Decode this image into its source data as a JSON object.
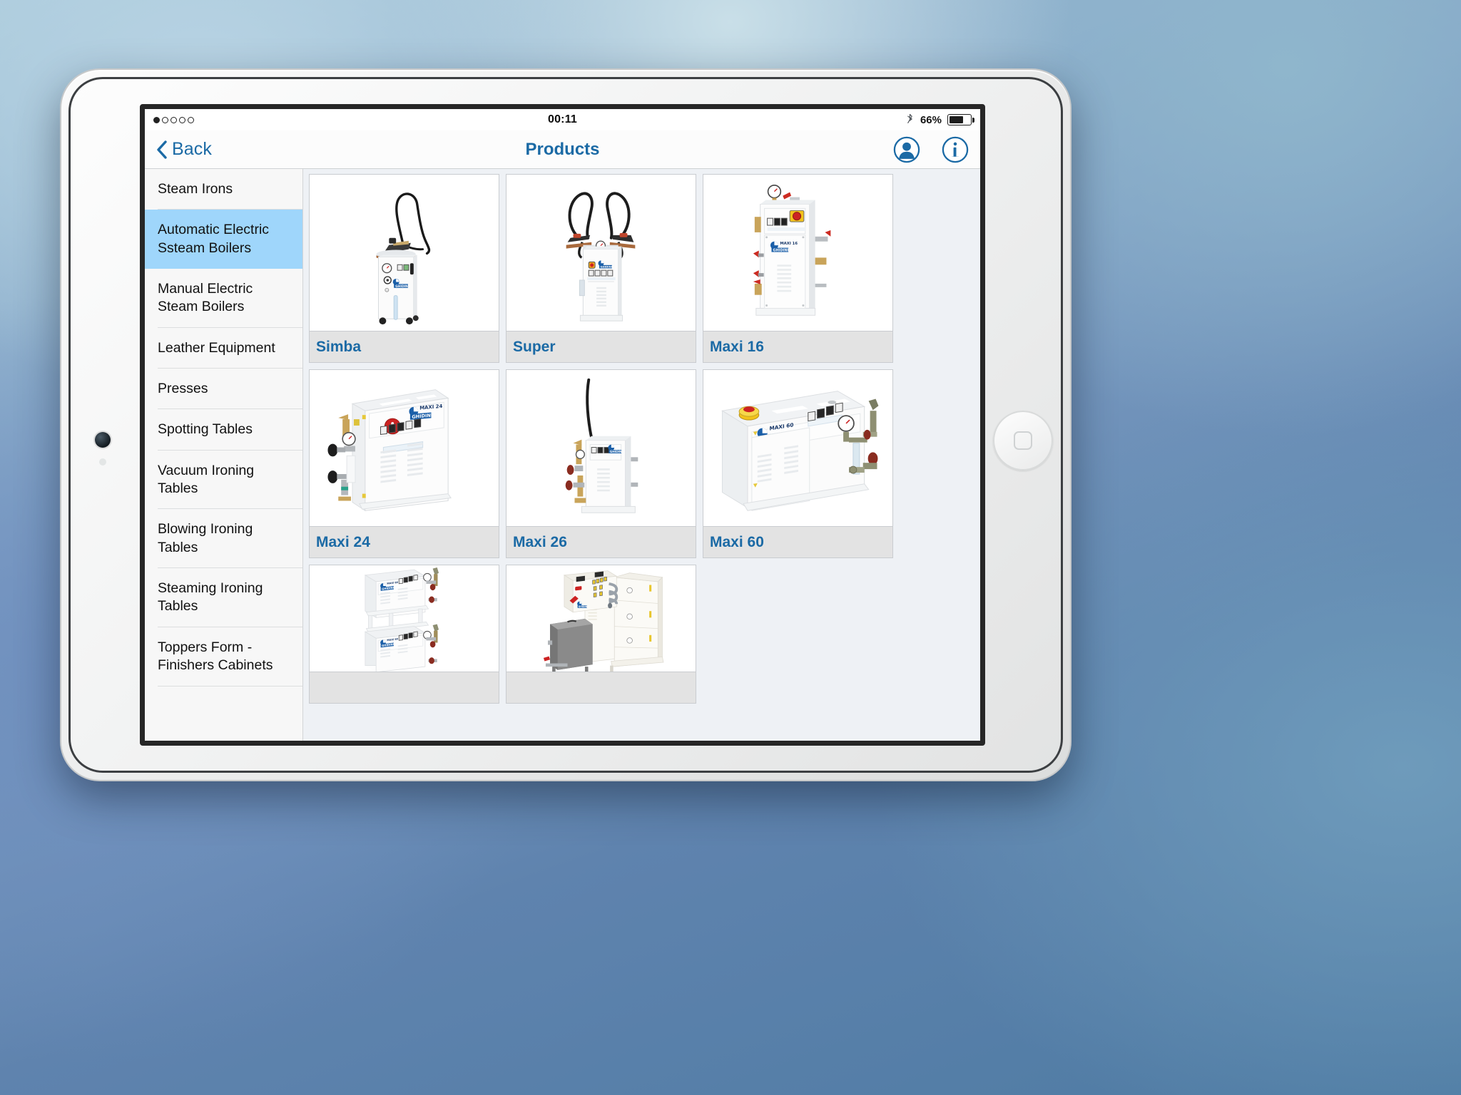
{
  "status_bar": {
    "signal_dots_total": 5,
    "signal_dots_filled": 1,
    "time": "00:11",
    "bluetooth_icon": "bluetooth-icon",
    "battery_percent_label": "66%",
    "battery_level": 66
  },
  "nav_bar": {
    "back_label": "Back",
    "back_icon": "chevron-left-icon",
    "title": "Products",
    "account_icon": "user-circle-icon",
    "info_icon": "info-circle-icon"
  },
  "sidebar": {
    "items": [
      {
        "label": "Steam Irons",
        "selected": false
      },
      {
        "label": "Automatic Electric Ssteam Boilers",
        "selected": true
      },
      {
        "label": "Manual Electric Steam Boilers",
        "selected": false
      },
      {
        "label": "Leather Equipment",
        "selected": false
      },
      {
        "label": "Presses",
        "selected": false
      },
      {
        "label": "Spotting Tables",
        "selected": false
      },
      {
        "label": "Vacuum Ironing Tables",
        "selected": false
      },
      {
        "label": "Blowing Ironing Tables",
        "selected": false
      },
      {
        "label": "Steaming Ironing Tables",
        "selected": false
      },
      {
        "label": "Toppers Form - Finishers Cabinets",
        "selected": false
      }
    ]
  },
  "products": {
    "items": [
      {
        "label": "Simba",
        "image": "simba-boiler-photo"
      },
      {
        "label": "Super",
        "image": "super-boiler-photo"
      },
      {
        "label": "Maxi 16",
        "image": "maxi16-boiler-photo"
      },
      {
        "label": "Maxi 24",
        "image": "maxi24-boiler-photo"
      },
      {
        "label": "Maxi 26",
        "image": "maxi26-boiler-photo"
      },
      {
        "label": "Maxi 60",
        "image": "maxi60-boiler-photo"
      },
      {
        "label": "",
        "image": "stacked-boilers-photo"
      },
      {
        "label": "",
        "image": "panel-tank-cabinets-photo"
      }
    ],
    "brand_on_units": "GHIDINI",
    "unit_badges": [
      "MAXI 24",
      "MAXI 16",
      "MAXI 60",
      "SUPER"
    ]
  },
  "colors": {
    "accent_blue": "#1b6aa5",
    "selection_blue": "#9fd6fb",
    "card_label_bg": "#e3e3e3",
    "grid_bg": "#eef1f5",
    "sidebar_bg": "#f7f7f7"
  }
}
